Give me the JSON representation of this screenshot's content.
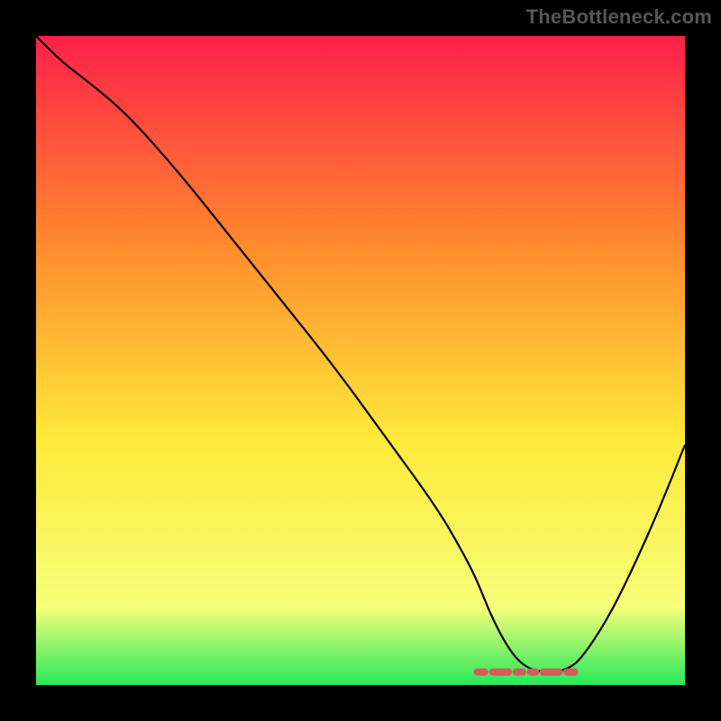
{
  "attribution": "TheBottleneck.com",
  "chart_data": {
    "type": "line",
    "title": "",
    "xlabel": "",
    "ylabel": "",
    "xlim": [
      0,
      100
    ],
    "ylim": [
      0,
      100
    ],
    "grid": false,
    "legend": false,
    "background_gradient": {
      "top": "#ff1f4a",
      "mid1": "#ff8a2d",
      "mid2": "#ffe93a",
      "low": "#f6ff7a",
      "bottom": "#27e85b"
    },
    "series": [
      {
        "name": "bottleneck-curve",
        "color": "#000000",
        "x": [
          0,
          4,
          8,
          14,
          22,
          30,
          38,
          46,
          54,
          62,
          66,
          68,
          70,
          72,
          74,
          76,
          78,
          80,
          82,
          84,
          88,
          92,
          96,
          100
        ],
        "y": [
          100,
          96,
          93,
          88,
          79,
          69,
          59,
          49,
          38,
          27,
          20,
          16,
          11,
          7,
          4,
          2.5,
          2,
          2,
          2.5,
          4,
          10,
          18,
          27,
          37
        ]
      }
    ],
    "highlight": {
      "name": "optimal-range-marker",
      "color": "#d65a5a",
      "style": "dashed",
      "y": 2,
      "x_range": [
        68,
        83
      ],
      "segments_x": [
        [
          68.0,
          69.2
        ],
        [
          70.4,
          72.8
        ],
        [
          74.0,
          75.0
        ],
        [
          76.2,
          77.0
        ],
        [
          78.2,
          80.6
        ],
        [
          81.8,
          83.0
        ]
      ]
    }
  }
}
